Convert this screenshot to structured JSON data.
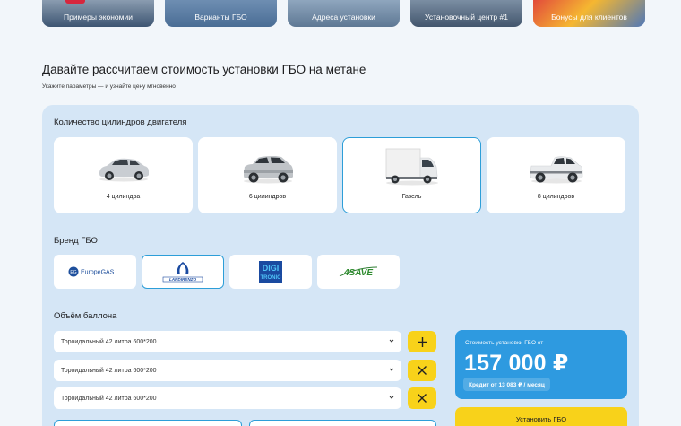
{
  "top_cards": [
    {
      "label": "Примеры экономии"
    },
    {
      "label": "Варианты ГБО"
    },
    {
      "label": "Адреса установки"
    },
    {
      "label": "Установочный центр #1"
    },
    {
      "label": "Бонусы для клиентов"
    }
  ],
  "heading": {
    "title": "Давайте рассчитаем стоимость установки ГБО на метане",
    "subtitle": "Укажите параметры — и узнайте цену мгновенно"
  },
  "cylinders": {
    "label": "Количество цилиндров двигателя",
    "options": [
      {
        "label": "4 цилиндра",
        "selected": false
      },
      {
        "label": "6 цилиндров",
        "selected": false
      },
      {
        "label": "Газель",
        "selected": true
      },
      {
        "label": "8 цилиндров",
        "selected": false
      }
    ]
  },
  "brand": {
    "label": "Бренд ГБО",
    "options": [
      {
        "name": "EuropeGAS",
        "selected": false
      },
      {
        "name": "LANDIRENZO",
        "selected": true
      },
      {
        "name": "DIGITRONIC",
        "logo_text": [
          "DIGI",
          "TRONIC"
        ],
        "selected": false
      },
      {
        "name": "4SAVE",
        "selected": false
      }
    ]
  },
  "tank": {
    "label": "Объём баллона",
    "rows": [
      {
        "value": "Тороидальный 42 литра 600*200",
        "action": "add"
      },
      {
        "value": "Тороидальный 42 литра 600*200",
        "action": "remove"
      },
      {
        "value": "Тороидальный 42 литра 600*200",
        "action": "remove"
      }
    ]
  },
  "price": {
    "label": "Стоимость установки ГБО от",
    "value": "157 000 ₽",
    "credit": "Кредит от 13 083 ₽ / месяц"
  },
  "install_button": {
    "label": "Установить ГБО"
  },
  "colors": {
    "accent_blue": "#2e9ae0",
    "accent_yellow": "#f8d21a",
    "panel_bg": "#d5e6f6",
    "selected_border": "#2d9ed8"
  }
}
